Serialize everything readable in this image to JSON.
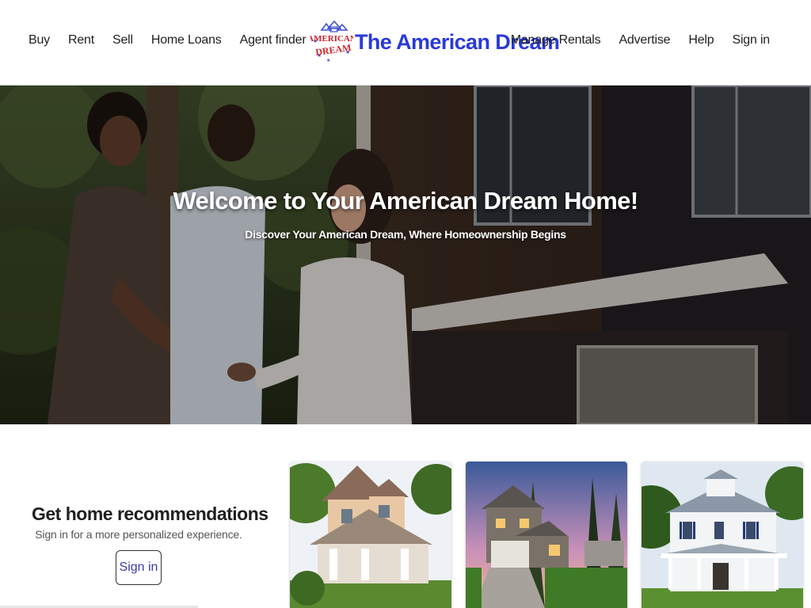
{
  "header": {
    "nav_left": [
      "Buy",
      "Rent",
      "Sell",
      "Home Loans",
      "Agent finder"
    ],
    "nav_right": [
      "Manage Rentals",
      "Advertise",
      "Help",
      "Sign in"
    ],
    "brand_name": "The American Dream",
    "logo_text_top": "AMERICAN",
    "logo_text_bottom": "DREAM",
    "brand_color": "#2a3ad6"
  },
  "hero": {
    "title": "Welcome to Your American Dream Home!",
    "subtitle": "Discover Your American Dream, Where Homeownership Begins"
  },
  "recommendations": {
    "title": "Get home recommendations",
    "subtitle": "Sign in for a more personalized experience.",
    "button_label": "Sign in"
  }
}
